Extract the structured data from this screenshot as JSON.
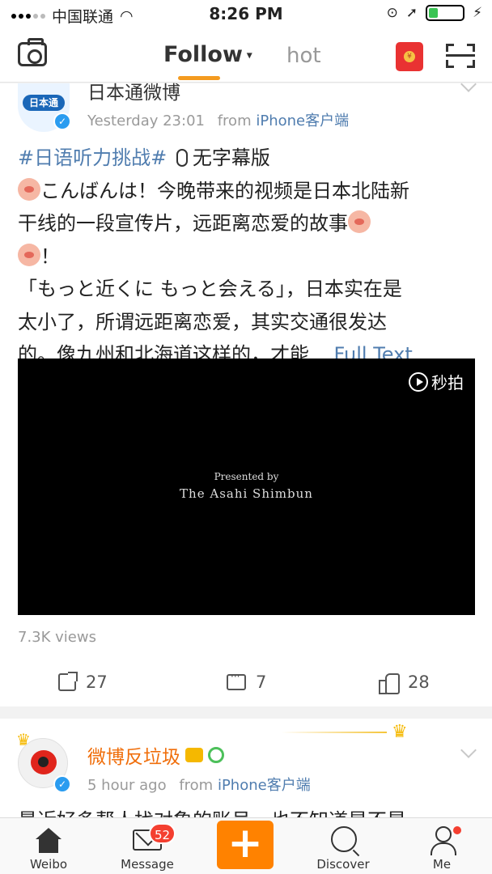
{
  "status_bar": {
    "carrier": "中国联通",
    "time": "8:26 PM",
    "battery_level": 0.24
  },
  "nav": {
    "tab_follow": "Follow",
    "tab_hot": "hot",
    "redpacket_glyph": "¥"
  },
  "post1": {
    "author": "日本通微博",
    "avatar_text": "日本通",
    "time": "Yesterday 23:01",
    "from_label": "from",
    "source": "iPhone客户端",
    "hashtag": "#日语听力挑战#",
    "line1_rest": "无字幕版",
    "line2": "こんばんは！今晚带来的视频是日本北陆新",
    "line3": "干线的一段宣传片，远距离恋爱的故事",
    "line4": "！",
    "line5": "「もっと近くに もっと会える」，日本实在是",
    "line6": "太小了，所谓远距离恋爱，其实交通很发达",
    "line7_text": "的。像九州和北海道这样的，才能...",
    "full_text": "Full Text",
    "video": {
      "brand": "秒拍",
      "caption_top": "Presented by",
      "caption_main": "The Asahi Shimbun"
    },
    "views": "7.3K views",
    "reposts": "27",
    "comments": "7",
    "likes": "28"
  },
  "post2": {
    "author": "微博反垃圾",
    "time": "5 hour ago",
    "from_label": "from",
    "source": "iPhone客户端",
    "preview": "最近好多帮人找对象的账号，也不知道是不是"
  },
  "tabbar": {
    "home": "Weibo",
    "message": "Message",
    "message_badge": "52",
    "compose": "+",
    "discover": "Discover",
    "me": "Me"
  },
  "colors": {
    "accent_orange": "#ff8200",
    "link_blue": "#507daf",
    "badge_red": "#f43f30"
  }
}
